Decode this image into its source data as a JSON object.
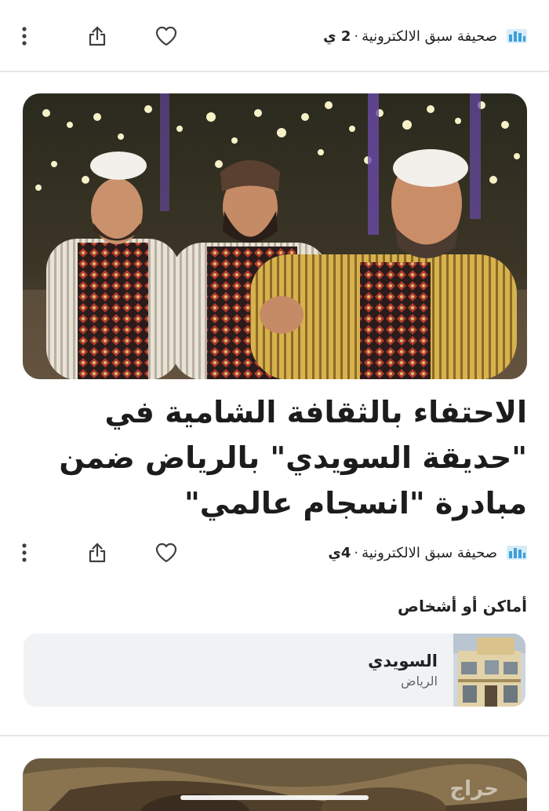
{
  "top_meta": {
    "source_name": "صحيفة سبق الالكترونية",
    "separator": "·",
    "age": "2 ي"
  },
  "article": {
    "headline": "الاحتفاء بالثقافة الشامية في \"حديقة السويدي\" بالرياض ضمن مبادرة \"انسجام عالمي\"",
    "source_name": "صحيفة سبق الالكترونية",
    "separator": "·",
    "age": "4ي"
  },
  "places": {
    "section_title": "أماكن أو أشخاص",
    "items": [
      {
        "name": "السويدي",
        "city": "الرياض"
      }
    ]
  },
  "watermark": "حراج",
  "colors": {
    "accent_logo": "#3aa0d8",
    "card_bg": "#f1f2f4",
    "divider": "#e6e6e6",
    "text": "#1c1c1c",
    "muted": "#5f6368"
  },
  "icons": {
    "more": "more-vert-icon",
    "share": "share-icon",
    "like": "heart-icon",
    "publisher": "publisher-logo-icon"
  }
}
